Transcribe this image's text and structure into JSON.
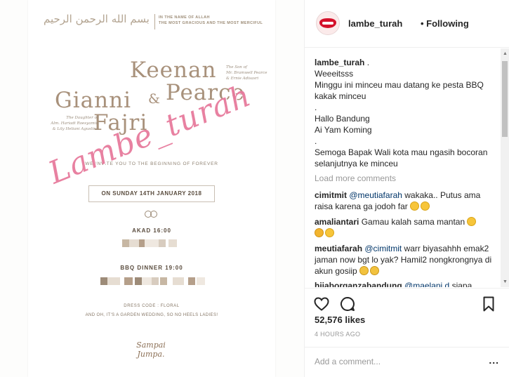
{
  "photo": {
    "header_arabic": "بسم الله الرحمن الرحيم",
    "header_bismillah": "IN THE NAME OF ALLAH\nTHE MOST GRACIOUS AND THE MOST MERCIFUL",
    "groom_first": "Keenan",
    "groom_last": "Pearce",
    "bride_first": "Gianni",
    "bride_last": "Fajri",
    "ampersand": "&",
    "groom_parents": "The Son of\nMr. Bramwell Pearce\n& Ernie Adisasri",
    "bride_parents": "The Daughter of\nAlm. Hariadi Roesyamin\n& Lily Heliani Agustina",
    "invite_line": "WE INVITE YOU TO THE BEGINNING OF FOREVER",
    "date_line": "ON SUNDAY 14TH JANUARY 2018",
    "akad": "AKAD 16:00",
    "bbq": "BBQ DINNER 19:00",
    "dress_code": "DRESS CODE : FLORAL",
    "garden_note": "AND OH, IT'S A GARDEN WEDDING, SO NO HEELS LADIES!",
    "closing": "Sampai Jumpa.",
    "watermark": "Lambe_turah"
  },
  "header": {
    "username": "lambe_turah",
    "follow_status": "• Following"
  },
  "caption": {
    "user": "lambe_turah",
    "first_line_suffix": " .",
    "lines": [
      "Weeeitsss",
      "Minggu ini minceu mau datang ke pesta BBQ kakak minceu",
      ".",
      "Hallo Bandung",
      "Ai Yam Koming",
      ".",
      "Semoga Bapak Wali kota mau ngasih bocoran selanjutnya ke minceu"
    ]
  },
  "load_more": "Load more comments",
  "comments": [
    {
      "user": "cimitmit",
      "mention": "@meutiafarah",
      "text": " wakaka.. Putus ama raisa karena ga jodoh far"
    },
    {
      "user": "amaliantari",
      "mention": "",
      "text": " Gamau kalah sama mantan"
    },
    {
      "user": "meutiafarah",
      "mention": "@cimitmit",
      "text": " warr biyasahhh emak2 jaman now bgt lo yak? Hamil2 nongkrongnya di akun gosiip"
    },
    {
      "user": "hijaborganzabandung",
      "mention": "@maelani.d",
      "text": " siapa"
    }
  ],
  "likes": "52,576 likes",
  "timestamp": "4 HOURS AGO",
  "add_comment_placeholder": "Add a comment...",
  "more_options": "..."
}
